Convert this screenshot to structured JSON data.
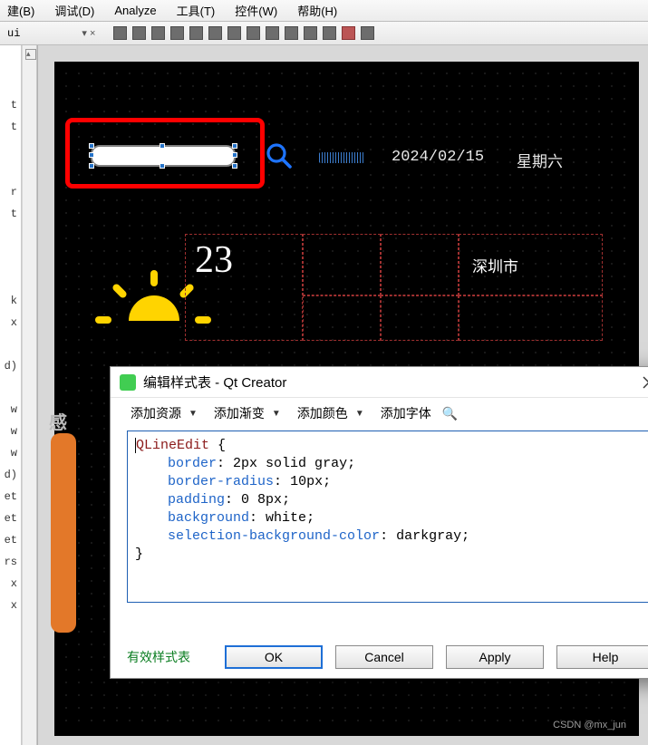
{
  "menu": {
    "build": "建(B)",
    "debug": "调试(D)",
    "analyze": "Analyze",
    "tools": "工具(T)",
    "widgets": "控件(W)",
    "help": "帮助(H)"
  },
  "toolbar": {
    "tab": "ui",
    "pin": "▾ ✕"
  },
  "side_items": [
    "",
    "t",
    "t",
    "",
    "",
    "r",
    "t",
    "",
    "",
    "",
    "k",
    "x",
    "",
    "d)",
    "",
    "w",
    "w",
    "w",
    "d)",
    "et",
    "et",
    "et",
    "rs",
    "x",
    "x"
  ],
  "form": {
    "date": "2024/02/15",
    "weekday": "星期六",
    "temperature": "23",
    "city": "深圳市",
    "left_label": "感"
  },
  "dialog": {
    "title": "编辑样式表 - Qt Creator",
    "tb_resource": "添加资源",
    "tb_gradient": "添加渐变",
    "tb_color": "添加颜色",
    "tb_font": "添加字体",
    "valid": "有效样式表",
    "ok": "OK",
    "cancel": "Cancel",
    "apply": "Apply",
    "help": "Help",
    "code": {
      "selector": "QLineEdit",
      "props": [
        {
          "name": "border",
          "value": "2px solid gray"
        },
        {
          "name": "border-radius",
          "value": "10px"
        },
        {
          "name": "padding",
          "value": "0 8px"
        },
        {
          "name": "background",
          "value": "white"
        },
        {
          "name": "selection-background-color",
          "value": "darkgray"
        }
      ]
    }
  },
  "watermark": "CSDN @mx_jun"
}
